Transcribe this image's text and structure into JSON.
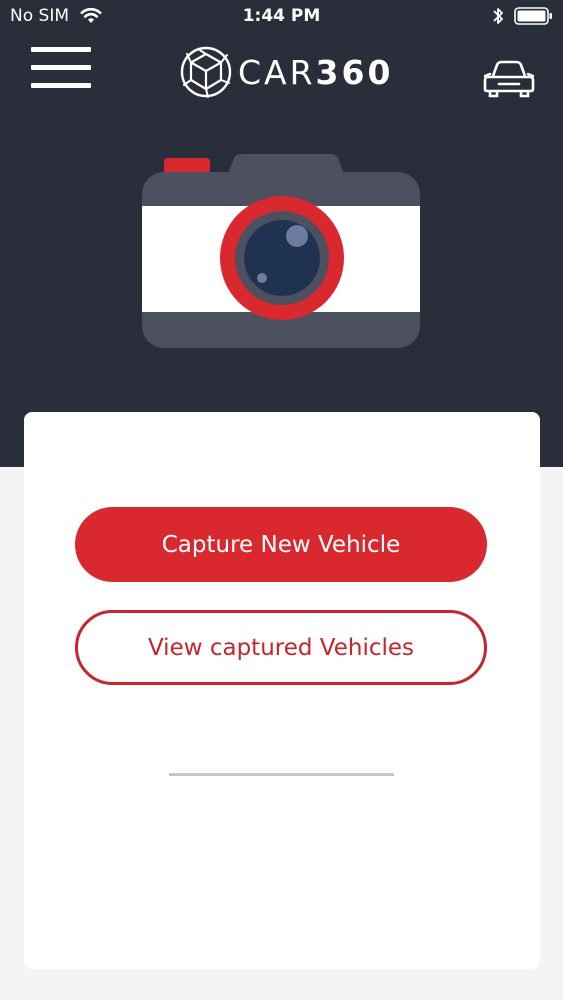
{
  "status_bar": {
    "carrier": "No SIM",
    "time": "1:44 PM"
  },
  "header": {
    "logo_text": "CAR",
    "logo_number": "360",
    "colors": {
      "background": "#2a2e3b",
      "accent": "#d9292e"
    }
  },
  "icons": {
    "menu": "hamburger-menu-icon",
    "logo": "camera-aperture-cube-icon",
    "vehicles": "car-icon",
    "illustration": "camera-illustration"
  },
  "actions": {
    "capture_label": "Capture New Vehicle",
    "view_label": "View captured Vehicles"
  }
}
